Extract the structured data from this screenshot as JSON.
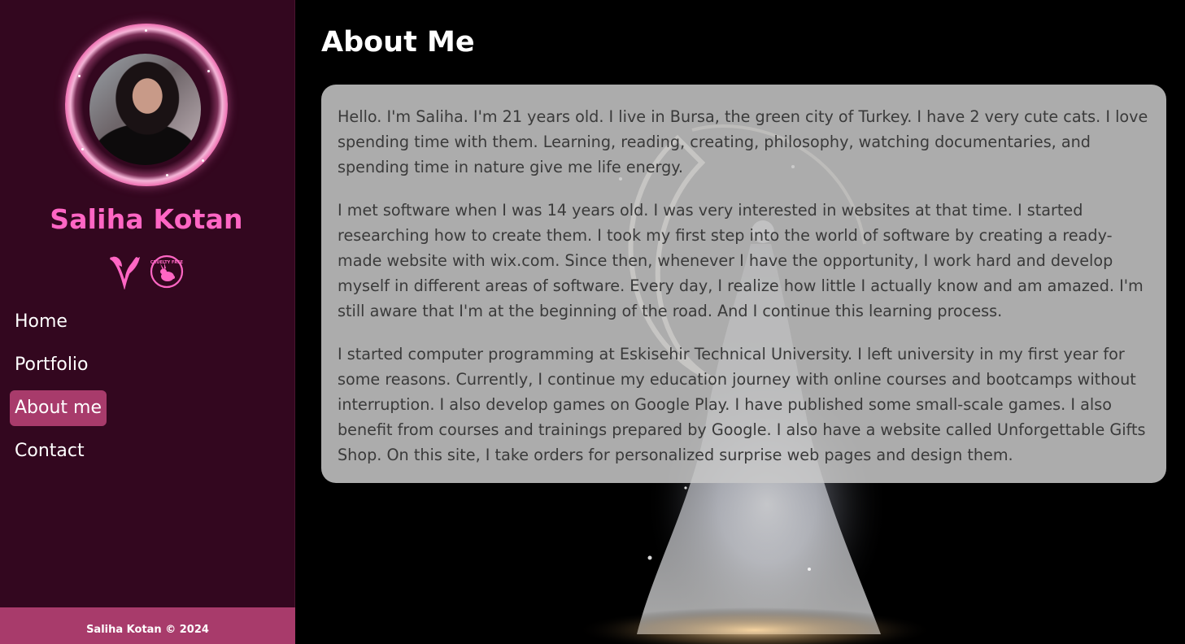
{
  "sidebar": {
    "name": "Saliha Kotan",
    "badges": [
      "vegan-icon",
      "cruelty-free-icon"
    ],
    "badge_text": "CRUELTY FREE",
    "nav": [
      {
        "label": "Home",
        "active": false
      },
      {
        "label": "Portfolio",
        "active": false
      },
      {
        "label": "About me",
        "active": true
      },
      {
        "label": "Contact",
        "active": false
      }
    ],
    "footer": "Saliha Kotan © 2024"
  },
  "main": {
    "title": "About Me",
    "paragraphs": [
      "Hello. I'm Saliha. I'm 21 years old. I live in Bursa, the green city of Turkey. I have 2 very cute cats. I love spending time with them. Learning, reading, creating, philosophy, watching documentaries, and spending time in nature give me life energy.",
      "I met software when I was 14 years old. I was very interested in websites at that time. I started researching how to create them. I took my first step into the world of software by creating a ready-made website with wix.com. Since then, whenever I have the opportunity, I work hard and develop myself in different areas of software. Every day, I realize how little I actually know and am amazed. I'm still aware that I'm at the beginning of the road. And I continue this learning process.",
      "I started computer programming at Eskisehir Technical University. I left university in my first year for some reasons. Currently, I continue my education journey with online courses and bootcamps without interruption. I also develop games on Google Play. I have published some small-scale games. I also benefit from courses and trainings prepared by Google. I also have a website called Unforgettable Gifts Shop. On this site, I take orders for personalized surprise web pages and design them."
    ]
  },
  "colors": {
    "sidebar_bg": "#33071f",
    "accent": "#a83b6b",
    "name_pink": "#ff66c4"
  }
}
